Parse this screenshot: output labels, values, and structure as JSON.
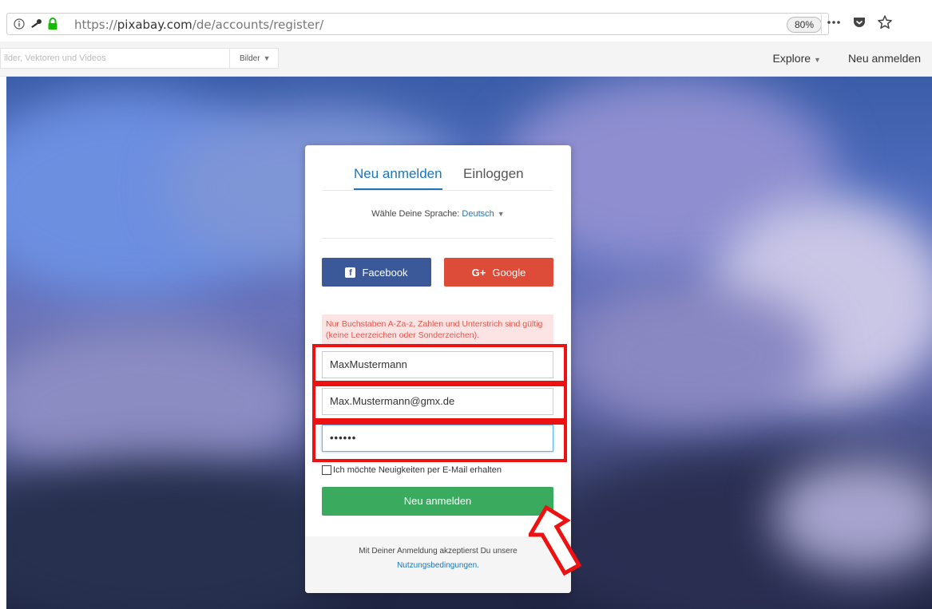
{
  "browser": {
    "url_prefix": "https://",
    "url_host": "pixabay.com",
    "url_path": "/de/accounts/register/",
    "zoom": "80%",
    "icons": [
      "info-icon",
      "key-icon",
      "lock-icon",
      "more-icon",
      "pocket-icon",
      "bookmark-star-icon"
    ]
  },
  "site_header": {
    "search_placeholder": "ilder, Vektoren und Videos",
    "search_type": "Bilder",
    "nav": {
      "explore": "Explore",
      "register": "Neu anmelden"
    }
  },
  "card": {
    "tabs": {
      "register": "Neu anmelden",
      "login": "Einloggen"
    },
    "language_label": "Wähle Deine Sprache:",
    "language_value": "Deutsch",
    "social": {
      "facebook": "Facebook",
      "google": "Google"
    },
    "error_message": "Nur Buchstaben A-Za-z, Zahlen und Unterstrich sind gültig (keine Leerzeichen oder Sonderzeichen).",
    "fields": {
      "username": "MaxMustermann",
      "email": "Max.Mustermann@gmx.de",
      "password": "••••••"
    },
    "newsletter_label": "Ich möchte Neuigkeiten per E-Mail erhalten",
    "submit_label": "Neu anmelden",
    "footer_text": "Mit Deiner Anmeldung akzeptierst Du unsere",
    "footer_link": "Nutzungsbedingungen."
  },
  "colors": {
    "accent": "#1c75bc",
    "facebook": "#3b5998",
    "google": "#dd4b39",
    "submit": "#3aaa5e",
    "annotation_red": "#ee1111"
  }
}
